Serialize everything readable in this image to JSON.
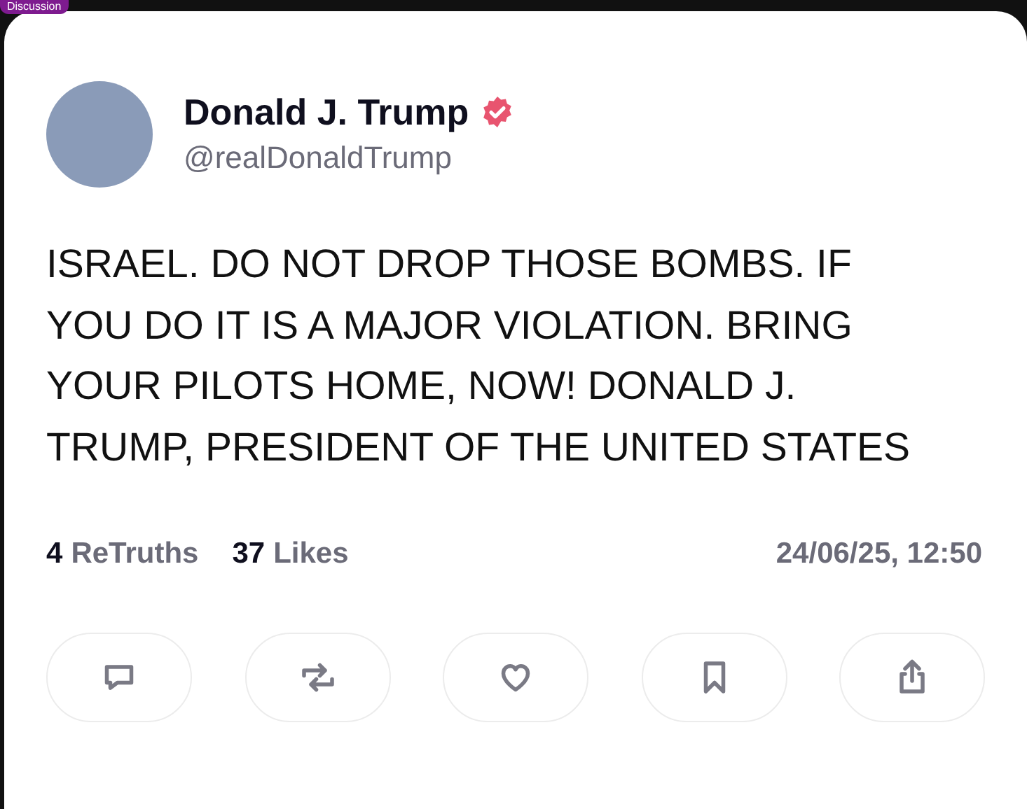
{
  "tag": "Discussion",
  "author": {
    "name": "Donald J. Trump",
    "verified": true,
    "handle": "@realDonaldTrump"
  },
  "post": {
    "text": "ISRAEL. DO NOT DROP THOSE BOMBS. IF YOU DO IT IS A MAJOR VIOLATION. BRING YOUR PILOTS HOME, NOW! DONALD J. TRUMP, PRESIDENT OF THE UNITED STATES"
  },
  "stats": [
    {
      "count": "4",
      "label": "ReTruths"
    },
    {
      "count": "37",
      "label": "Likes"
    }
  ],
  "timestamp": "24/06/25, 12:50",
  "actions": [
    {
      "kind": "reply"
    },
    {
      "kind": "retruth"
    },
    {
      "kind": "like"
    },
    {
      "kind": "bookmark"
    },
    {
      "kind": "share"
    }
  ]
}
